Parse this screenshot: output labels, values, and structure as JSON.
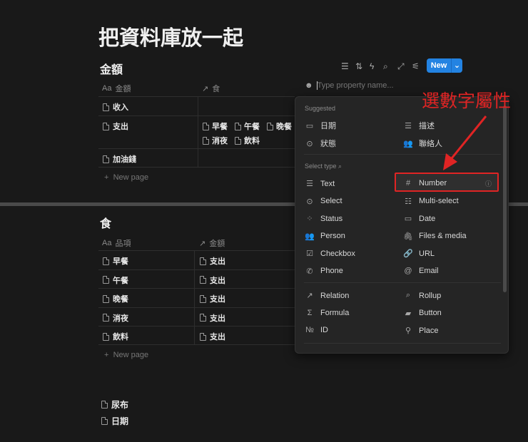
{
  "page_title": "把資料庫放一起",
  "db1": {
    "title": "金額",
    "col1": "金額",
    "col2": "食",
    "rows": [
      {
        "name": "收入",
        "rel": []
      },
      {
        "name": "支出",
        "rel": [
          "早餐",
          "午餐",
          "晚餐",
          "消夜",
          "飲料"
        ]
      },
      {
        "name": "加油錢",
        "rel": []
      }
    ],
    "new_page": "New page"
  },
  "toolbar": {
    "new_label": "New"
  },
  "property_input": {
    "placeholder": "Type property name..."
  },
  "menu": {
    "suggested_label": "Suggested",
    "suggested": [
      "日期",
      "描述",
      "狀態",
      "聯絡人"
    ],
    "select_type_label": "Select type",
    "types": [
      "Text",
      "Number",
      "Select",
      "Multi-select",
      "Status",
      "Date",
      "Person",
      "Files & media",
      "Checkbox",
      "URL",
      "Phone",
      "Email"
    ],
    "advanced": [
      "Relation",
      "Rollup",
      "Formula",
      "Button",
      "ID",
      "Place"
    ]
  },
  "annotation": "選數字屬性",
  "db2": {
    "title": "食",
    "col1": "品項",
    "col2": "金額",
    "rows": [
      {
        "name": "早餐",
        "rel": "支出"
      },
      {
        "name": "午餐",
        "rel": "支出"
      },
      {
        "name": "晚餐",
        "rel": "支出"
      },
      {
        "name": "消夜",
        "rel": "支出"
      },
      {
        "name": "飲料",
        "rel": "支出"
      }
    ],
    "new_page": "New page"
  },
  "pages": [
    "尿布",
    "日期"
  ],
  "colors": {
    "accent": "#2383e2",
    "annotation": "#e02424",
    "bg": "#191919"
  }
}
